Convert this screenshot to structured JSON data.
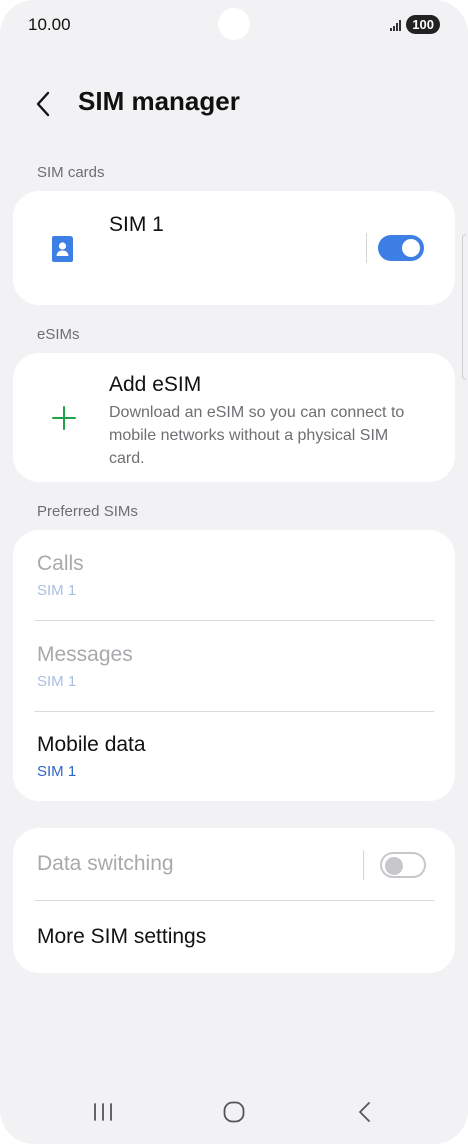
{
  "status_bar": {
    "time": "10.00",
    "battery": "100",
    "signal_icon": "signal-icon"
  },
  "header": {
    "title": "SIM manager",
    "back_icon": "chevron-left-icon"
  },
  "sections": {
    "sim_cards": "SIM cards",
    "esims": "eSIMs",
    "preferred": "Preferred SIMs"
  },
  "sim_card": {
    "name": "SIM 1",
    "icon": "sim-card-icon",
    "enabled": true,
    "accent": "#3e7fe6"
  },
  "add_esim": {
    "title": "Add eSIM",
    "description": "Download an eSIM so you can connect to mobile networks without a physical SIM card.",
    "icon": "plus-icon",
    "icon_color": "#1fa24a"
  },
  "preferred_sims": [
    {
      "label": "Calls",
      "value": "SIM 1",
      "enabled": false
    },
    {
      "label": "Messages",
      "value": "SIM 1",
      "enabled": false
    },
    {
      "label": "Mobile data",
      "value": "SIM 1",
      "enabled": true
    }
  ],
  "more": {
    "data_switching": {
      "label": "Data switching",
      "enabled": false,
      "on": false
    },
    "more_settings": "More SIM settings"
  },
  "navbar": {
    "recent_icon": "recent-apps-icon",
    "home_icon": "home-icon",
    "back_icon": "back-icon"
  }
}
